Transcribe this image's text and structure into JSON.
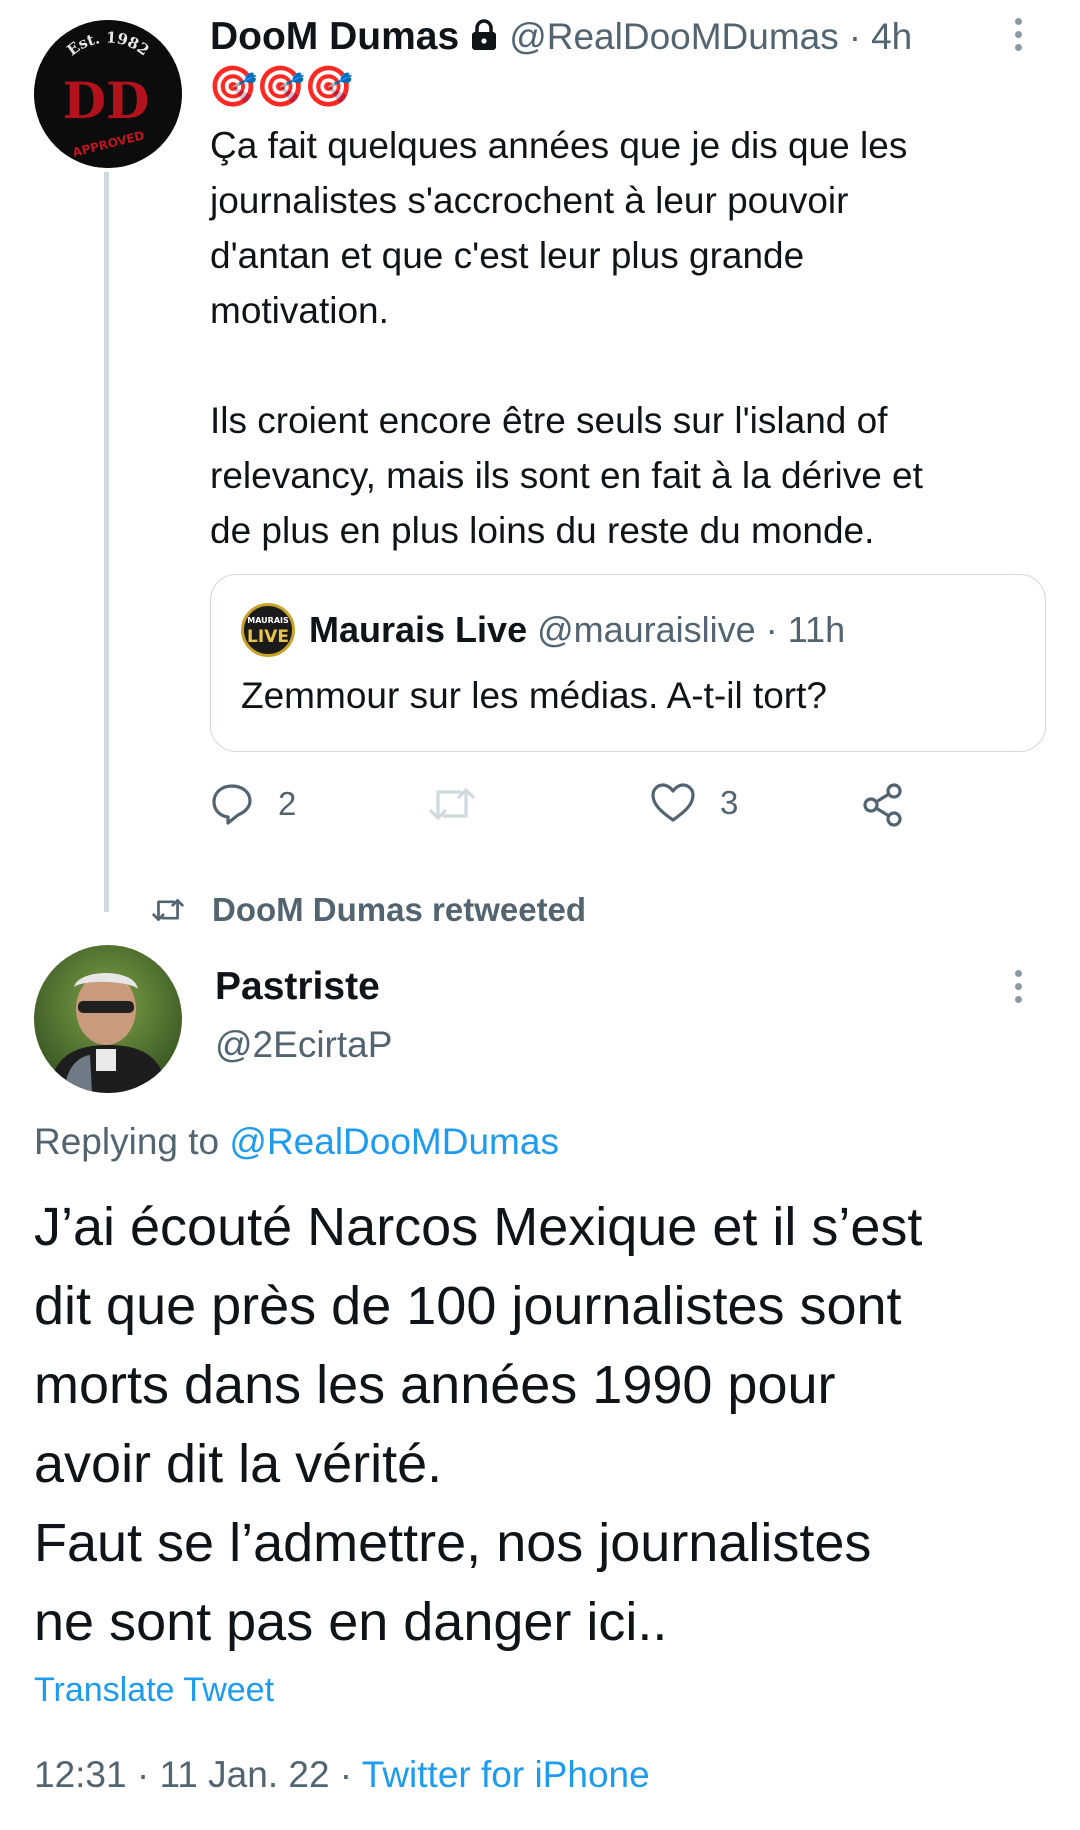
{
  "tweet1": {
    "author_name": "DooM Dumas",
    "handle": "@RealDooMDumas",
    "time": "4h",
    "emojis": "🎯🎯🎯",
    "avatar": {
      "top_text": "Est. 1982",
      "initials": "DD",
      "stamp": "APPROVED"
    },
    "body": "Ça fait quelques années que je dis que les\njournalistes s'accrochent à leur pouvoir\nd'antan et que c'est leur plus grande\nmotivation.\n\nIls croient encore être seuls sur l'island of\nrelevancy, mais ils sont en fait à la dérive et\nde plus en plus loins du reste du monde.",
    "quote": {
      "avatar_text_top": "MAURAIS",
      "avatar_text_bottom": "LIVE",
      "author_name": "Maurais Live",
      "handle": "@mauraislive",
      "time": "11h",
      "text": "Zemmour sur les médias. A-t-il tort?"
    },
    "actions": {
      "replies": "2",
      "likes": "3"
    }
  },
  "retweet_label": "DooM Dumas retweeted",
  "tweet2": {
    "author_name": "Pastriste",
    "handle": "@2EcirtaP",
    "replying_prefix": "Replying to",
    "replying_handle": "@RealDooMDumas",
    "body": "J’ai écouté Narcos Mexique et il s’est\ndit que près de 100 journalistes sont\nmorts dans les années 1990 pour\navoir dit la vérité.\nFaut se l’admettre, nos journalistes\nne sont pas en danger ici..",
    "translate_label": "Translate Tweet",
    "timestamp": "12:31 · 11 Jan. 22 ·",
    "source": "Twitter for iPhone"
  },
  "colors": {
    "link": "#1d9bf0",
    "muted": "#536471",
    "text": "#0f1419"
  }
}
